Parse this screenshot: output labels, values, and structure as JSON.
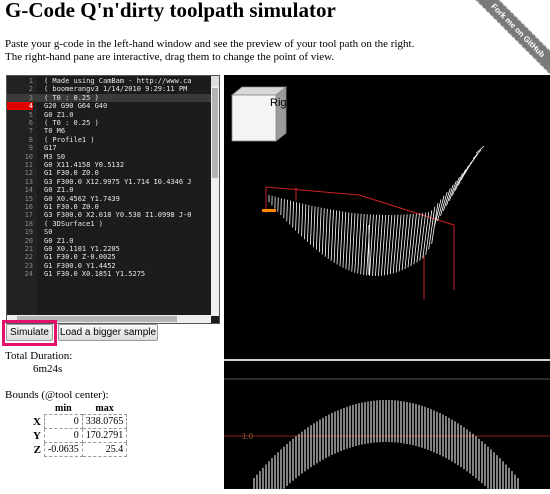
{
  "header": {
    "title": "G-Code Q'n'dirty toolpath simulator",
    "intro_line1": "Paste your g-code in the left-hand window and see the preview of your tool path on the right.",
    "intro_line2": "The right-hand pane are interactive, drag them to change the point of view.",
    "ribbon": "Fork me on GitHub"
  },
  "editor": {
    "lines": [
      {
        "n": "1",
        "t": "( Made using CamBam - http://www.ca"
      },
      {
        "n": "2",
        "t": "( boomerangv3 1/14/2010 9:29:11 PM"
      },
      {
        "n": "3",
        "t": "( T0 : 0.25 )"
      },
      {
        "n": "4",
        "t": "G20 G90 G64 G40"
      },
      {
        "n": "5",
        "t": "G0 Z1.0"
      },
      {
        "n": "6",
        "t": "( T0 : 0.25 )"
      },
      {
        "n": "7",
        "t": "T0 M6"
      },
      {
        "n": "8",
        "t": "( Profile1 )"
      },
      {
        "n": "9",
        "t": "G17"
      },
      {
        "n": "10",
        "t": "M3 S0"
      },
      {
        "n": "11",
        "t": "G0 X11.4158 Y0.5132"
      },
      {
        "n": "12",
        "t": "G1 F30.0 Z0.0"
      },
      {
        "n": "13",
        "t": "G3 F300.0 X12.9975 Y1.714 I0.4346 J"
      },
      {
        "n": "14",
        "t": "G0 Z1.0"
      },
      {
        "n": "15",
        "t": "G0 X0.4562 Y1.7439"
      },
      {
        "n": "16",
        "t": "G1 F30.0 Z0.0"
      },
      {
        "n": "17",
        "t": "G3 F300.0 X2.018 Y0.538 I1.0998 J-0"
      },
      {
        "n": "18",
        "t": "( 3DSurface1 )"
      },
      {
        "n": "19",
        "t": "S0"
      },
      {
        "n": "20",
        "t": "G0 Z1.0"
      },
      {
        "n": "21",
        "t": "G0 X0.1101 Y1.2205"
      },
      {
        "n": "22",
        "t": "G1 F30.0 Z-0.0025"
      },
      {
        "n": "23",
        "t": "G1 F300.0 Y1.4452"
      },
      {
        "n": "24",
        "t": "G1 F30.0 X0.1851 Y1.5275"
      }
    ]
  },
  "buttons": {
    "simulate": "Simulate",
    "bigger_sample": "Load a bigger sample"
  },
  "stats": {
    "duration_label": "Total Duration:",
    "duration_value": "6m24s",
    "bounds_label": "Bounds (@tool center):",
    "col_min": "min",
    "col_max": "max",
    "rows": [
      {
        "axis": "X",
        "min": "0",
        "max": "338.0765"
      },
      {
        "axis": "Y",
        "min": "0",
        "max": "170.2791"
      },
      {
        "axis": "Z",
        "min": "-0.0635",
        "max": "25.4"
      }
    ]
  },
  "viewer": {
    "cube_label": "Right",
    "axis_marker": "1.0"
  },
  "colors": {
    "highlight": "#e3116c",
    "error_gutter": "#e00000",
    "viewer_bg": "#000000",
    "toolpath": "#ffffff",
    "bound_lines": "#cc2222"
  }
}
